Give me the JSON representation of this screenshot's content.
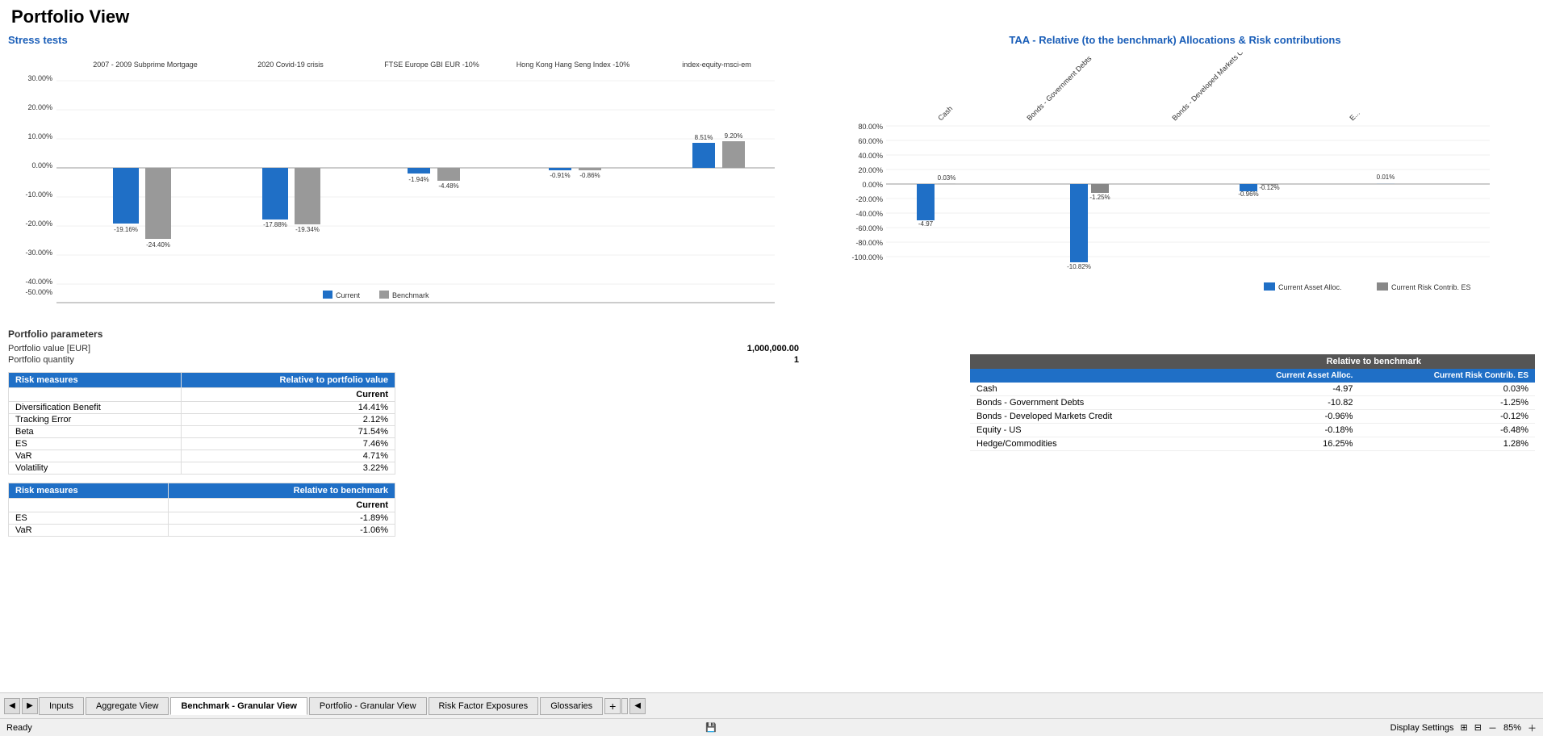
{
  "page": {
    "title": "Portfolio View"
  },
  "stress_section": {
    "title": "Stress tests",
    "groups": [
      {
        "label": "2007 - 2009 Subprime Mortgage",
        "current_val": -19.16,
        "benchmark_val": -24.4,
        "current_label": "-19.16%",
        "benchmark_label": "-24.40%"
      },
      {
        "label": "2020 Covid-19 crisis",
        "current_val": -17.88,
        "benchmark_val": -19.34,
        "current_label": "-17.88%",
        "benchmark_label": "-19.34%"
      },
      {
        "label": "FTSE Europe GBI EUR -10%",
        "current_val": -1.94,
        "benchmark_val": -4.48,
        "current_label": "-1.94%",
        "benchmark_label": "-4.48%"
      },
      {
        "label": "Hong Kong Hang Seng Index -10%",
        "current_val": -0.91,
        "benchmark_val": -0.86,
        "current_label": "-0.91%",
        "benchmark_label": "-0.86%"
      },
      {
        "label": "index-equity-msci-em",
        "current_val": 8.51,
        "benchmark_val": 9.2,
        "current_label": "8.51%",
        "benchmark_label": "9.20%"
      }
    ],
    "y_axis": [
      "30.00%",
      "20.00%",
      "10.00%",
      "0.00%",
      "-10.00%",
      "-20.00%",
      "-30.00%",
      "-40.00%",
      "-50.00%"
    ],
    "legend": {
      "current": "Current",
      "benchmark": "Benchmark"
    }
  },
  "portfolio_params": {
    "title": "Portfolio parameters",
    "value_label": "Portfolio value  [EUR]",
    "value": "1,000,000.00",
    "quantity_label": "Portfolio quantity",
    "quantity": "1"
  },
  "risk_measures_1": {
    "title": "Risk measures",
    "subtitle": "Relative to portfolio value",
    "current_label": "Current",
    "rows": [
      {
        "label": "Diversification Benefit",
        "value": "14.41%"
      },
      {
        "label": "Tracking Error",
        "value": "2.12%"
      },
      {
        "label": "Beta",
        "value": "71.54%"
      },
      {
        "label": "ES",
        "value": "7.46%"
      },
      {
        "label": "VaR",
        "value": "4.71%"
      },
      {
        "label": "Volatility",
        "value": "3.22%"
      }
    ]
  },
  "risk_measures_2": {
    "title": "Risk measures",
    "subtitle": "Relative to benchmark",
    "current_label": "Current",
    "rows": [
      {
        "label": "ES",
        "value": "-1.89%"
      },
      {
        "label": "VaR",
        "value": "-1.06%"
      }
    ]
  },
  "taa": {
    "title": "TAA - Relative (to the benchmark) Allocations & Risk contributions",
    "categories": [
      "Cash",
      "Bonds - Government Debts",
      "Bonds - Developed Markets Credit",
      "E..."
    ],
    "y_axis": [
      "80.00%",
      "60.00%",
      "40.00%",
      "20.00%",
      "0.00%",
      "-20.00%",
      "-40.00%",
      "-60.00%",
      "-80.00%",
      "-100.00%"
    ],
    "bars": [
      {
        "label": "Cash",
        "alloc": -4.97,
        "risk": 0.03
      },
      {
        "label": "Bonds - Government Debts",
        "alloc": -10.82,
        "risk": -1.25
      },
      {
        "label": "Bonds - Developed Markets Credit",
        "alloc": -0.96,
        "risk": -0.12
      },
      {
        "label": "E...",
        "alloc": 0.01,
        "risk": -1.0
      }
    ],
    "legend": {
      "alloc": "Current Asset Alloc.",
      "risk": "Current Risk Contrib. ES"
    }
  },
  "benchmark_table": {
    "header": "Relative to benchmark",
    "col1": "Current Asset Alloc.",
    "col2": "Current Risk Contrib. ES",
    "rows": [
      {
        "label": "Cash",
        "alloc": "-4.97",
        "risk": "0.03%"
      },
      {
        "label": "Bonds - Government Debts",
        "alloc": "-10.82",
        "risk": "-1.25%"
      },
      {
        "label": "Bonds - Developed Markets Credit",
        "alloc": "-0.96%",
        "risk": "-0.12%"
      },
      {
        "label": "Equity - US",
        "alloc": "-0.18%",
        "risk": "-6.48%"
      },
      {
        "label": "Hedge/Commodities",
        "alloc": "16.25%",
        "risk": "1.28%"
      }
    ]
  },
  "bottom_tabs": {
    "tabs": [
      {
        "label": "Inputs",
        "active": false
      },
      {
        "label": "Aggregate View",
        "active": false
      },
      {
        "label": "Benchmark - Granular View",
        "active": true
      },
      {
        "label": "Portfolio - Granular View",
        "active": false
      },
      {
        "label": "Risk Factor Exposures",
        "active": false
      },
      {
        "label": "Glossaries",
        "active": false
      }
    ]
  },
  "status": {
    "ready": "Ready",
    "zoom": "85%",
    "display_settings": "Display Settings"
  }
}
